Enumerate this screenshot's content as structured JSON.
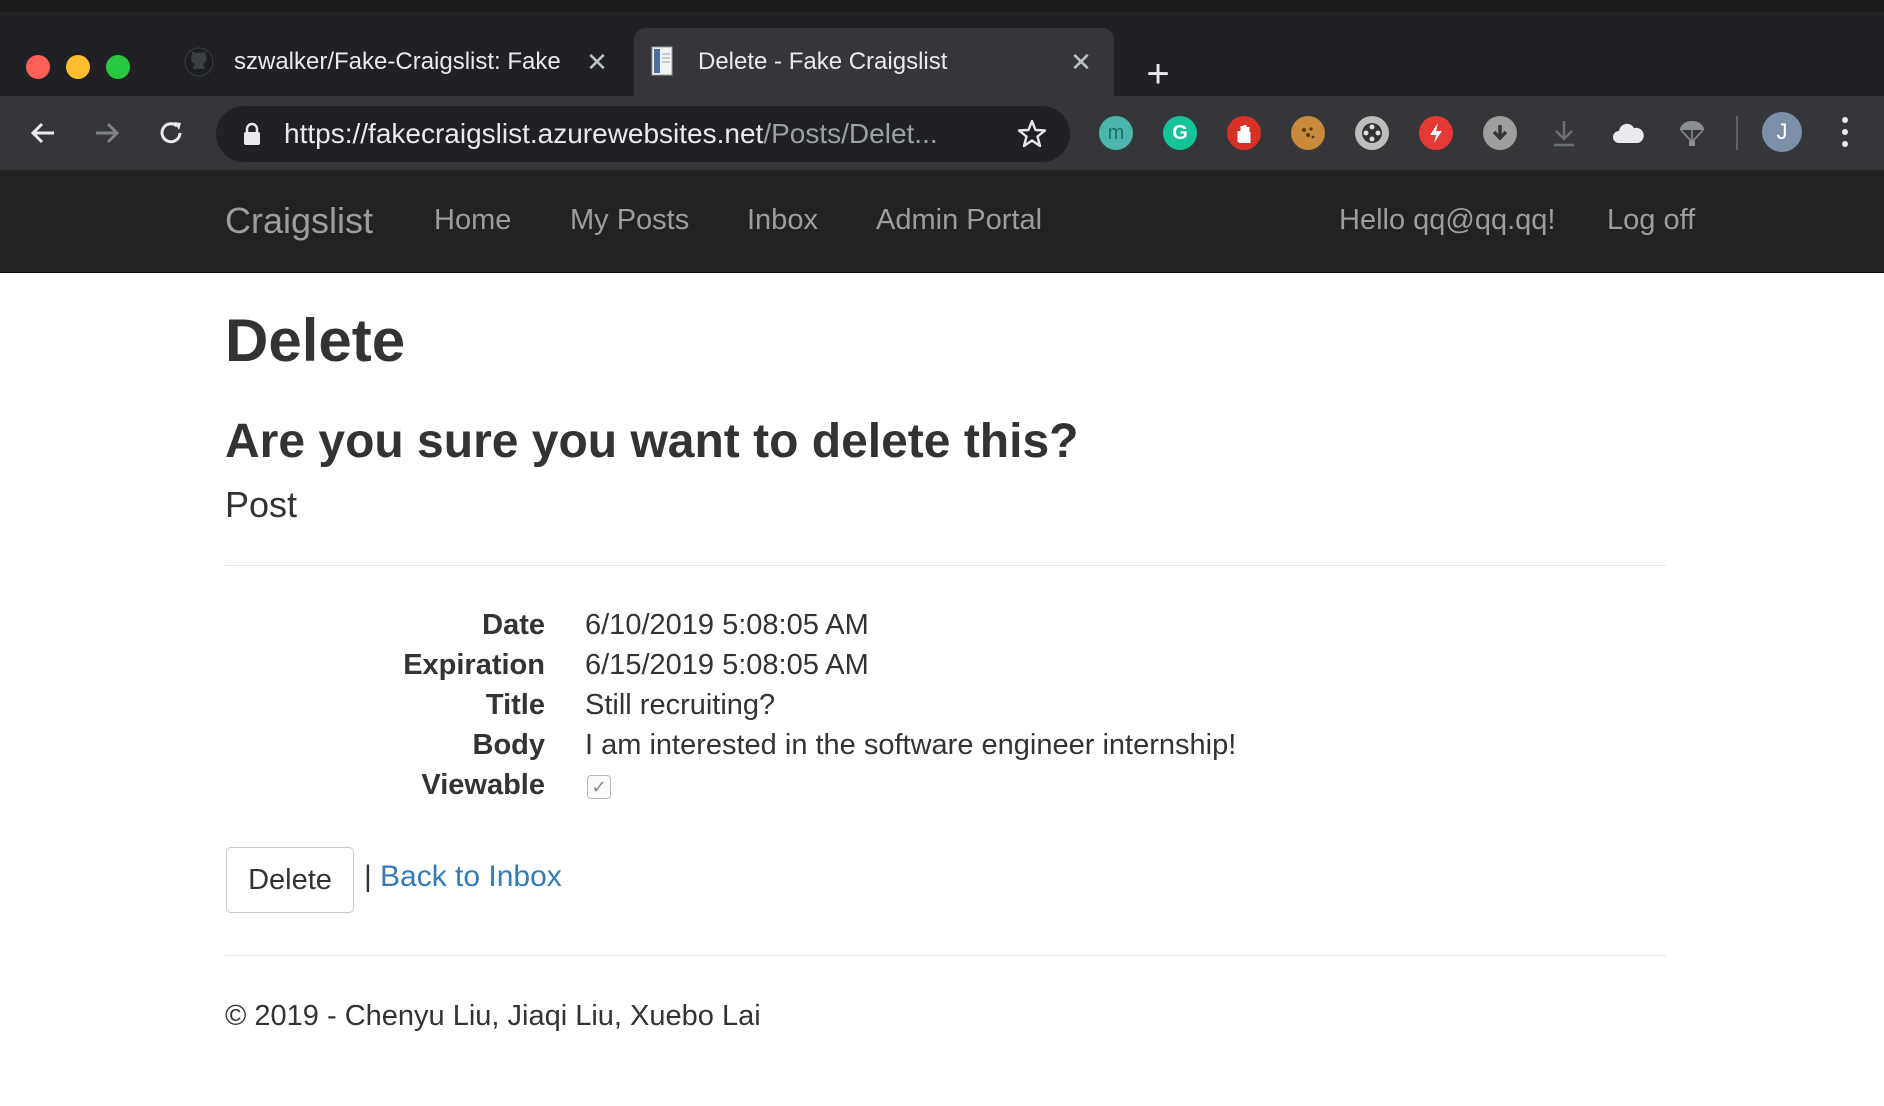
{
  "browser": {
    "tabs": [
      {
        "title": "szwalker/Fake-Craigslist: Fake",
        "favicon": "github-icon",
        "active": false
      },
      {
        "title": "Delete - Fake Craigslist",
        "favicon": "document-icon",
        "active": true
      }
    ],
    "url_host": "https://fakecraigslist.azurewebsites.net",
    "url_path": "/Posts/Delet...",
    "profile_initial": "J",
    "extensions": [
      "mercury-icon",
      "grammarly-icon",
      "adblock-hand-icon",
      "cookie-icon",
      "film-reel-icon",
      "bolt-icon",
      "download-circle-icon",
      "download-arrow-icon",
      "cloud-icon",
      "parachute-icon"
    ],
    "extension_labels": {
      "mercury": "m",
      "grammarly": "G"
    }
  },
  "navbar": {
    "brand": "Craigslist",
    "links": [
      "Home",
      "My Posts",
      "Inbox",
      "Admin Portal"
    ],
    "greeting": "Hello qq@qq.qq!",
    "logoff": "Log off"
  },
  "page": {
    "heading": "Delete",
    "confirm": "Are you sure you want to delete this?",
    "subheading": "Post",
    "details": {
      "date_label": "Date",
      "date_value": "6/10/2019 5:08:05 AM",
      "expiration_label": "Expiration",
      "expiration_value": "6/15/2019 5:08:05 AM",
      "title_label": "Title",
      "title_value": "Still recruiting?",
      "body_label": "Body",
      "body_value": "I am interested in the software engineer internship!",
      "viewable_label": "Viewable",
      "viewable_checked": true
    },
    "delete_button": "Delete",
    "separator": "|",
    "back_link": "Back to Inbox",
    "footer": "© 2019 - Chenyu Liu, Jiaqi Liu, Xuebo Lai"
  },
  "colors": {
    "navbar_bg": "#222222",
    "navbar_text": "#9d9d9d",
    "link": "#337ab7",
    "chrome_dark": "#202124",
    "chrome_toolbar": "#35363a"
  }
}
